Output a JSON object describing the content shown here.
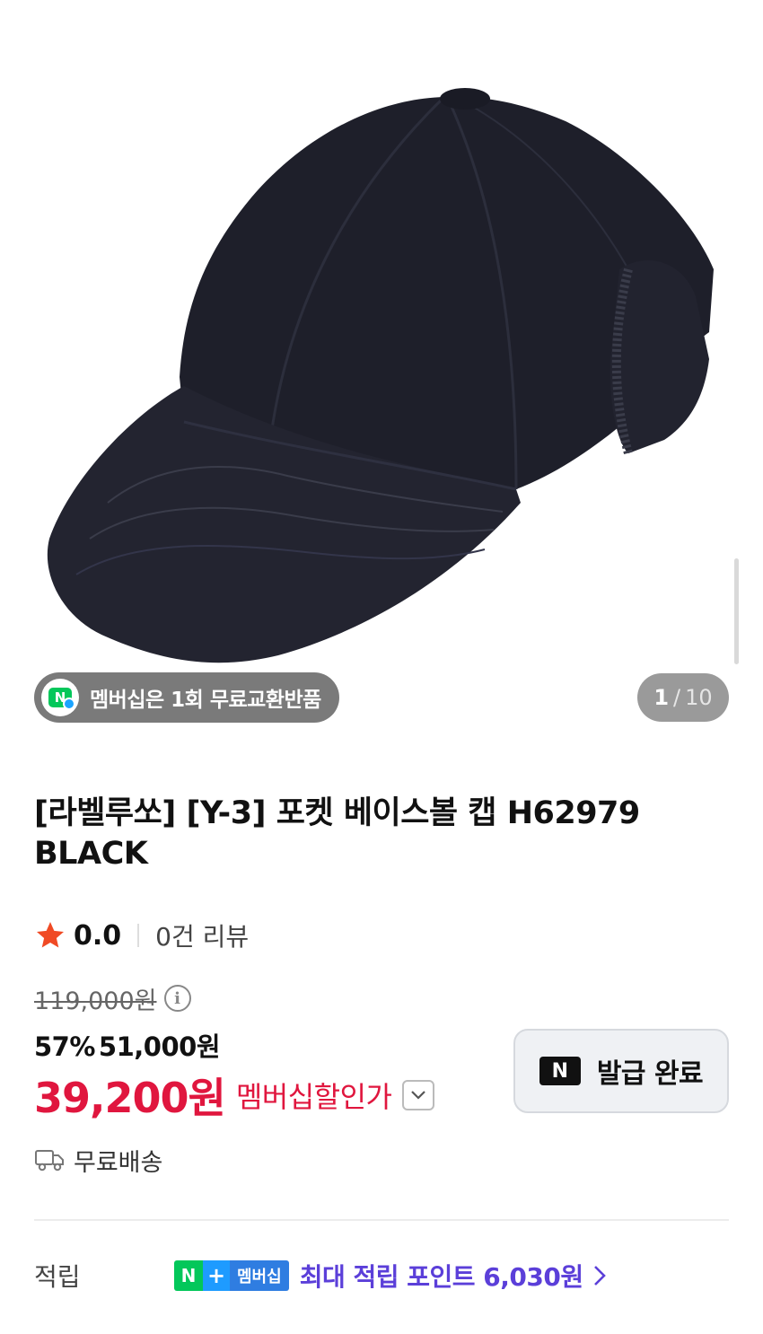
{
  "gallery": {
    "membership_pill": "멤버십은 1회 무료교환반품",
    "counter_current": "1",
    "counter_separator": "/",
    "counter_total": "10"
  },
  "product": {
    "title": "[라벨루쏘] [Y-3] 포켓 베이스볼 캡 H62979 BLACK",
    "rating": "0.0",
    "review_count": "0건 리뷰",
    "original_price": "119,000원",
    "discount_percent": "57%",
    "sale_price": "51,000원",
    "member_price": "39,200원",
    "member_price_label": "멤버십할인가",
    "coupon_badge": "N",
    "coupon_status": "발급 완료",
    "shipping": "무료배송"
  },
  "points": {
    "label": "적립",
    "badge_n": "N",
    "badge_plus": "+",
    "badge_member": "멤버십",
    "text": "최대 적립 포인트 6,030원"
  },
  "colors": {
    "price_red": "#e0163e",
    "naver_green": "#03c75a",
    "points_purple": "#5b3fd9",
    "star_red": "#f04a24"
  }
}
